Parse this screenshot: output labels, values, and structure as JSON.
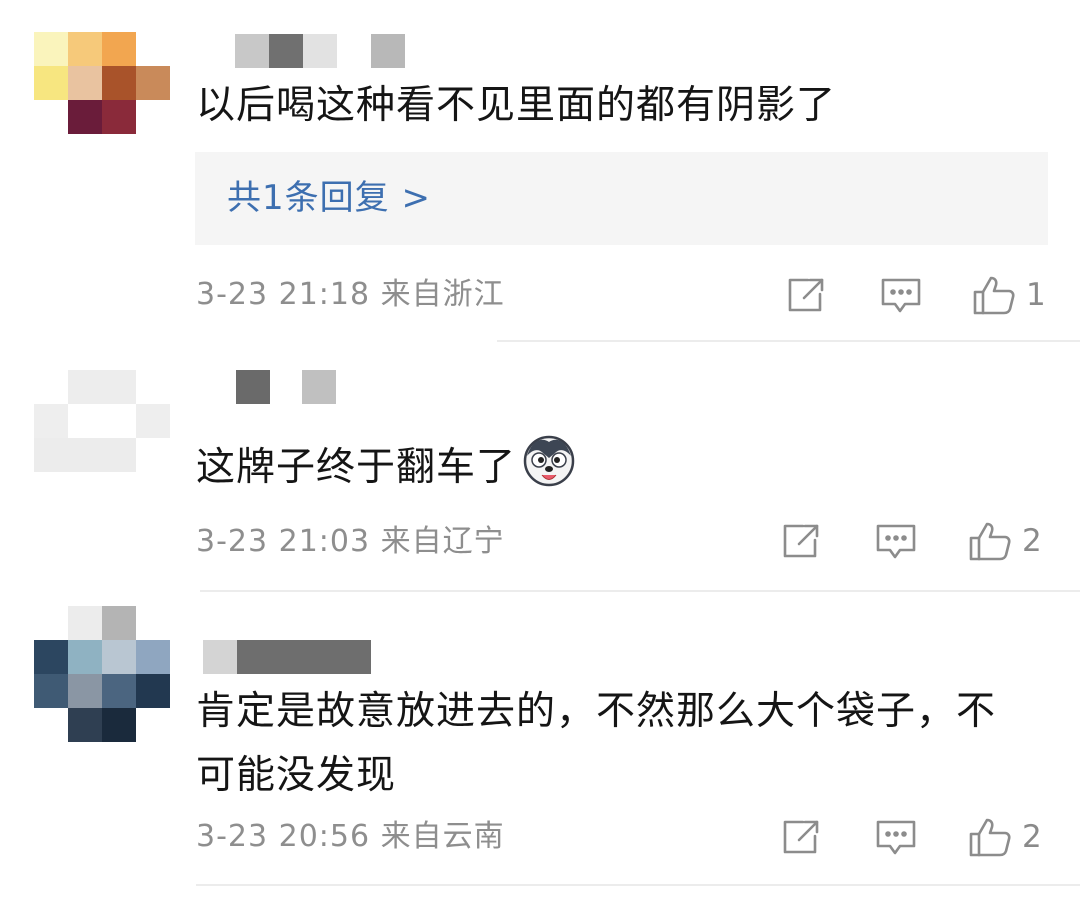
{
  "comments": [
    {
      "text": "以后喝这种看不见里面的都有阴影了",
      "reply_label": "共1条回复 >",
      "time": "3-23 21:18",
      "location": "来自浙江",
      "likes": "1"
    },
    {
      "text": "这牌子终于翻车了",
      "emoji": "husky-emoji",
      "time": "3-23 21:03",
      "location": "来自辽宁",
      "likes": "2"
    },
    {
      "text_line1": "肯定是故意放进去的，不然那么大个袋子，不",
      "text_line2": "可能没发现",
      "time": "3-23 20:56",
      "location": "来自云南",
      "likes": "2"
    }
  ],
  "icons": {
    "share": "share-icon",
    "comment": "comment-icon",
    "like": "thumbs-up-icon"
  },
  "colors": {
    "link_blue": "#3d6fb0",
    "meta_gray": "#8e8e8e",
    "reply_bg": "#f5f5f5"
  }
}
